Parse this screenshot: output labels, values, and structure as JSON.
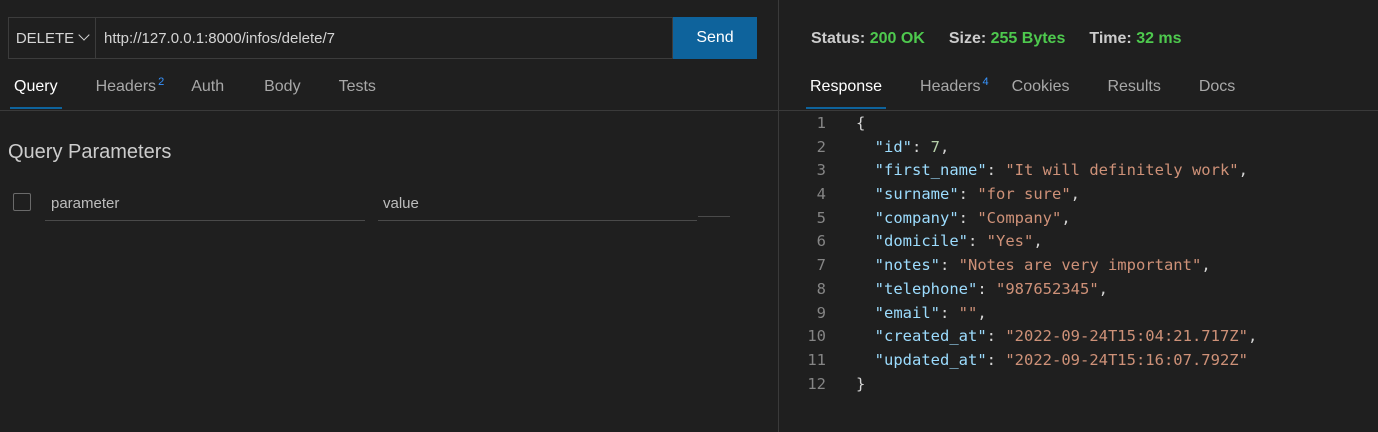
{
  "request": {
    "method": "DELETE",
    "url": "http://127.0.0.1:8000/infos/delete/7",
    "send_label": "Send"
  },
  "request_tabs": [
    {
      "label": "Query",
      "badge": ""
    },
    {
      "label": "Headers",
      "badge": "2"
    },
    {
      "label": "Auth",
      "badge": ""
    },
    {
      "label": "Body",
      "badge": ""
    },
    {
      "label": "Tests",
      "badge": ""
    }
  ],
  "query": {
    "title": "Query Parameters",
    "param_placeholder": "parameter",
    "value_placeholder": "value"
  },
  "status": {
    "status_label": "Status:",
    "status_value": "200 OK",
    "size_label": "Size:",
    "size_value": "255 Bytes",
    "time_label": "Time:",
    "time_value": "32 ms"
  },
  "response_tabs": [
    {
      "label": "Response",
      "badge": ""
    },
    {
      "label": "Headers",
      "badge": "4"
    },
    {
      "label": "Cookies",
      "badge": ""
    },
    {
      "label": "Results",
      "badge": ""
    },
    {
      "label": "Docs",
      "badge": ""
    }
  ],
  "response_body": [
    {
      "n": "1",
      "type": "open",
      "text": "{"
    },
    {
      "n": "2",
      "key": "id",
      "num": "7",
      "comma": ","
    },
    {
      "n": "3",
      "key": "first_name",
      "str": "It will definitely work",
      "comma": ","
    },
    {
      "n": "4",
      "key": "surname",
      "str": "for sure",
      "comma": ","
    },
    {
      "n": "5",
      "key": "company",
      "str": "Company",
      "comma": ","
    },
    {
      "n": "6",
      "key": "domicile",
      "str": "Yes",
      "comma": ","
    },
    {
      "n": "7",
      "key": "notes",
      "str": "Notes are very important",
      "comma": ","
    },
    {
      "n": "8",
      "key": "telephone",
      "str": "987652345",
      "comma": ","
    },
    {
      "n": "9",
      "key": "email",
      "str": "",
      "comma": ","
    },
    {
      "n": "10",
      "key": "created_at",
      "str": "2022-09-24T15:04:21.717Z",
      "comma": ","
    },
    {
      "n": "11",
      "key": "updated_at",
      "str": "2022-09-24T15:16:07.792Z",
      "comma": ""
    },
    {
      "n": "12",
      "type": "close",
      "text": "}"
    }
  ]
}
